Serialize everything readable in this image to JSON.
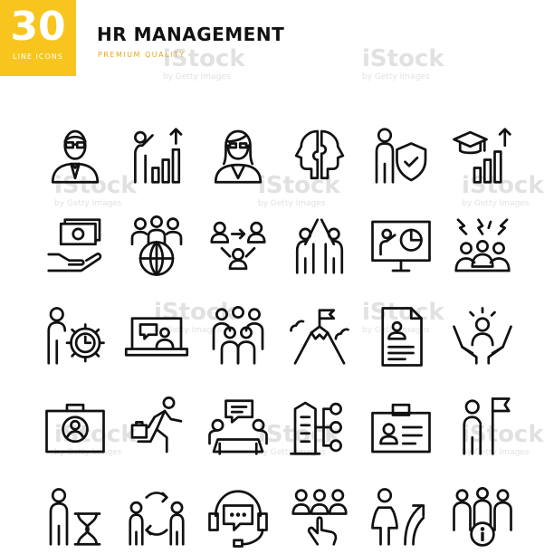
{
  "badge": {
    "number": "30",
    "label": "LINE ICONS"
  },
  "header": {
    "title": "HR MANAGEMENT",
    "subtitle": "PREMIUM QUALITY"
  },
  "colors": {
    "accent": "#f7c51e",
    "subtitle": "#e7a81c",
    "icon": "#111111"
  },
  "watermark": {
    "brand": "iStock",
    "credit": "by Getty Images"
  },
  "icons": [
    "businessman-icon",
    "growth-chart-icon",
    "businesswoman-icon",
    "puzzle-heads-icon",
    "person-shield-icon",
    "graduation-growth-icon",
    "money-hand-icon",
    "global-team-icon",
    "network-icon",
    "high-five-icon",
    "presentation-screen-icon",
    "conflict-team-icon",
    "person-time-gear-icon",
    "video-call-laptop-icon",
    "team-group-icon",
    "mountain-flag-icon",
    "resume-document-icon",
    "person-care-hands-icon",
    "portfolio-case-icon",
    "running-businessman-icon",
    "meeting-chat-icon",
    "building-hierarchy-icon",
    "id-badge-icon",
    "person-flag-icon",
    "person-hourglass-icon",
    "exchange-people-icon",
    "support-headset-icon",
    "team-touch-icon",
    "woman-growth-icon",
    "team-info-icon"
  ]
}
